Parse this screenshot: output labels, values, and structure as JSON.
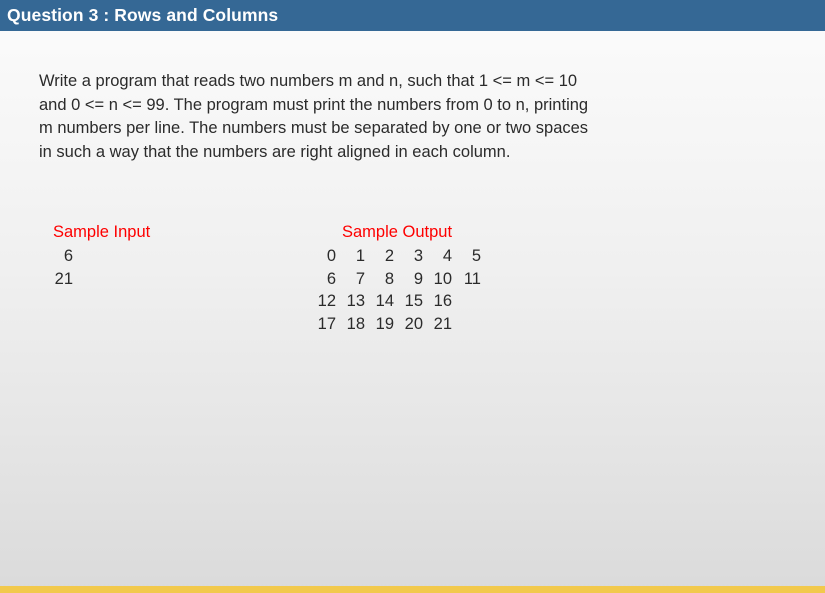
{
  "slide": {
    "title": "Question 3 : Rows and Columns",
    "problem_statement": "Write a program that reads two numbers m and n, such that 1 <= m <= 10\nand 0 <= n <= 99. The program must print the numbers from 0 to n, printing\nm numbers per line. The numbers must be separated by one or two spaces\nin such a way that the numbers are right aligned in each column.",
    "samples": {
      "input": {
        "heading": "Sample Input",
        "rows": [
          [
            "6"
          ],
          [
            "21"
          ]
        ]
      },
      "output": {
        "heading": "Sample Output",
        "rows": [
          [
            "0",
            "1",
            "2",
            "3",
            "4",
            "5"
          ],
          [
            "6",
            "7",
            "8",
            "9",
            "10",
            "11"
          ],
          [
            "12",
            "13",
            "14",
            "15",
            "16"
          ],
          [
            "17",
            "18",
            "19",
            "20",
            "21"
          ]
        ]
      }
    },
    "colors": {
      "title_bar": "#356895",
      "title_text": "#ffffff",
      "sample_heading": "#fe0000",
      "body_text": "#2b2b2b",
      "footer_strip": "#f2c94c"
    }
  }
}
